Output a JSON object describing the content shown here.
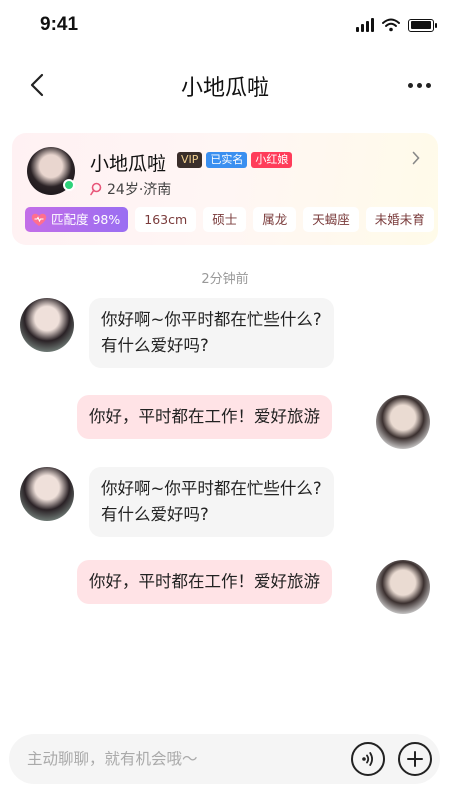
{
  "status_bar": {
    "time": "9:41",
    "battery_level": 1.0
  },
  "nav": {
    "title": "小地瓜啦"
  },
  "profile": {
    "name": "小地瓜啦",
    "badges": [
      "VIP",
      "已实名",
      "小红娘"
    ],
    "meta": "24岁·济南",
    "match_label": "匹配度 98%",
    "tags": [
      "163cm",
      "硕士",
      "属龙",
      "天蝎座",
      "未婚未育"
    ],
    "online": true
  },
  "chat": {
    "time_label": "2分钟前",
    "messages": [
      {
        "from": "her",
        "text_line1": "你好啊~你平时都在忙些什么?",
        "text_line2": "有什么爱好吗?"
      },
      {
        "from": "me",
        "text": "你好，平时都在工作！爱好旅游"
      },
      {
        "from": "her",
        "text_line1": "你好啊~你平时都在忙些什么?",
        "text_line2": "有什么爱好吗?"
      },
      {
        "from": "me",
        "text": "你好，平时都在工作！爱好旅游"
      }
    ]
  },
  "input": {
    "placeholder": "主动聊聊，就有机会哦～",
    "value": ""
  },
  "icons": {
    "back": "back-arrow-icon",
    "more": "more-icon",
    "location": "location-pin-icon",
    "chevron": "chevron-right-icon",
    "heart": "heart-icon",
    "voice": "voice-icon",
    "plus": "plus-icon"
  },
  "colors": {
    "accent": "#ff3d5a",
    "outgoing_bubble": "#ffe3e6",
    "incoming_bubble": "#f5f5f5",
    "online": "#2ed37a"
  }
}
